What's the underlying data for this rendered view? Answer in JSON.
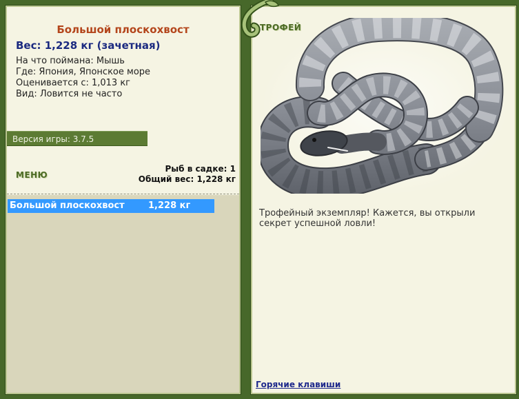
{
  "fish": {
    "name": "Большой плоскохвост",
    "weight_line": "Вес: 1,228 кг (зачетная)",
    "bait_line": "На что поймана: Мышь",
    "location_line": "Где: Япония, Японское море",
    "valued_line": "Оценивается с: 1,013 кг",
    "rarity_line": "Вид: Ловится не часто"
  },
  "version": {
    "label": "Версия игры: 3.7.5"
  },
  "menu": {
    "label": "МЕНЮ"
  },
  "keepnet": {
    "count_line": "Рыб в садке: 1",
    "total_line": "Общий вес: 1,228 кг"
  },
  "catch_list": [
    {
      "name": "Большой плоскохвост",
      "weight": "1,228 кг",
      "selected": true
    }
  ],
  "trophy": {
    "label": "ТРОФЕЙ",
    "message": "Трофейный экземпляр! Кажется, вы открыли секрет успешной ловли!"
  },
  "footer": {
    "hotkeys_link": "Горячие клавиши"
  },
  "icons": {
    "trophy_image": "snake-trophy-image",
    "decoration": "vine-swirl-icon"
  },
  "colors": {
    "background": "#47682a",
    "panel": "#f5f4e3",
    "panel_border": "#b9c58f",
    "list_area": "#d9d6bb",
    "version_bar": "#5c7b33",
    "selection": "#3399ff",
    "title": "#b4461c",
    "weight": "#1b2a80",
    "label_green": "#4c6a24",
    "link": "#1f2a8c"
  }
}
